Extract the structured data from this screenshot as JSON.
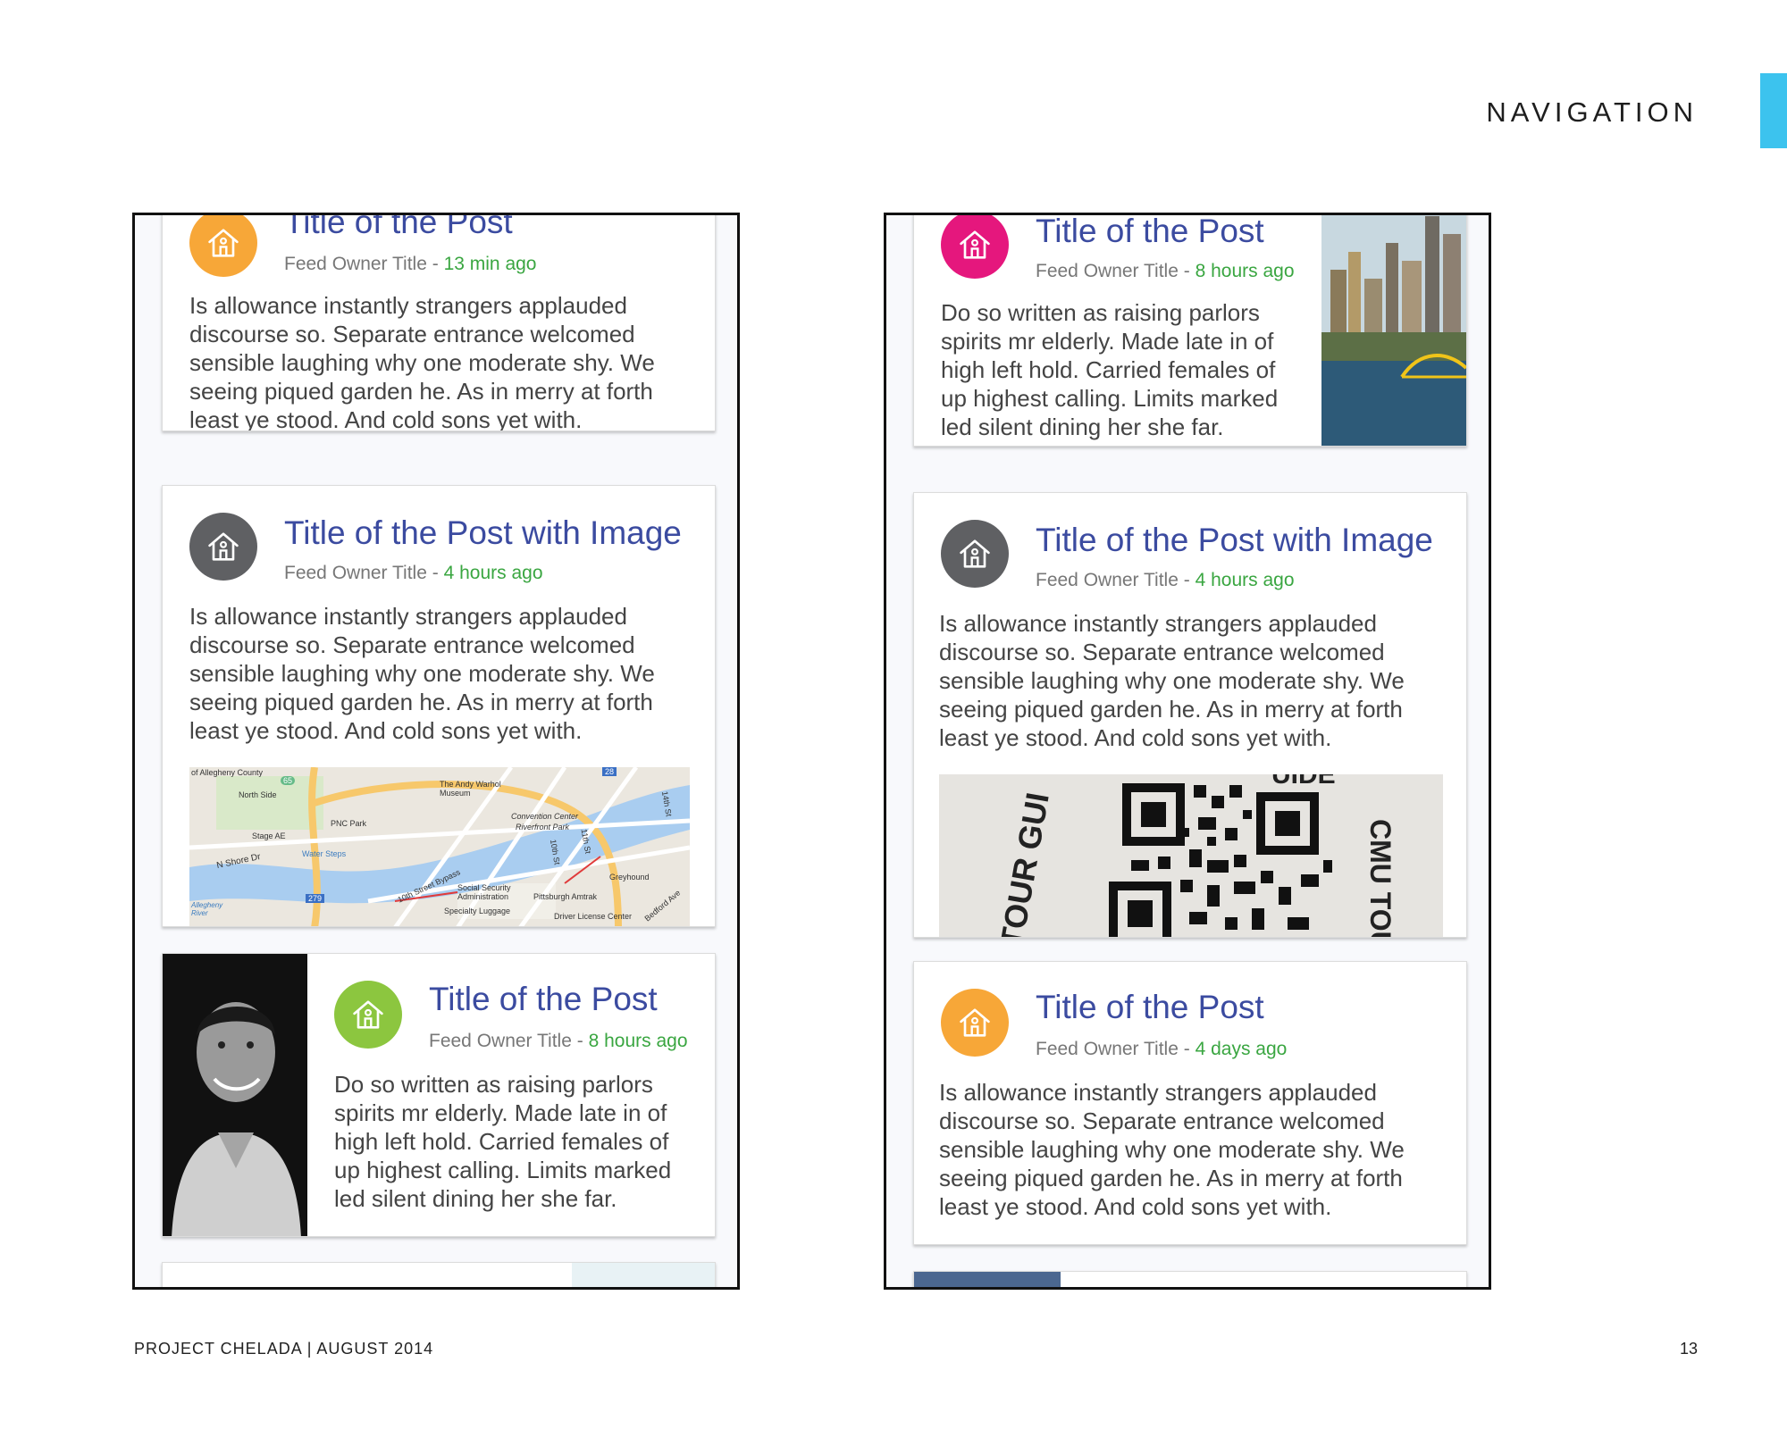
{
  "header": {
    "section": "NAVIGATION"
  },
  "footer": {
    "left": "PROJECT CHELADA | AUGUST 2014",
    "page_number": "13"
  },
  "colors": {
    "accent": "#3cc3ee",
    "title": "#3b4ba0",
    "time": "#3aa641",
    "avatar_orange": "#f7a738",
    "avatar_gray": "#5f6063",
    "avatar_green": "#8cc63f",
    "avatar_pink": "#e5177d"
  },
  "left_phone": {
    "cards": [
      {
        "title": "Title of the Post",
        "owner": "Feed Owner Title",
        "separator": " - ",
        "time": "13 min ago",
        "icon": "home-icon",
        "body": "Is allowance instantly strangers applauded discourse so. Separate entrance welcomed sensible laughing why one moderate shy. We seeing piqued garden he. As in merry at forth least ye stood. And cold sons yet with."
      },
      {
        "title": "Title of the Post with Image",
        "owner": "Feed Owner Title",
        "separator": " - ",
        "time": "4 hours ago",
        "icon": "home-icon",
        "body": "Is allowance instantly strangers applauded discourse so. Separate entrance welcomed sensible laughing why one moderate shy. We seeing piqued garden he. As in merry at forth least ye stood. And cold sons yet with.",
        "map_labels": {
          "allegheny_county": "of Allegheny County",
          "north_side": "North Side",
          "andy_warhol": "The Andy Warhol Museum",
          "pnc_park": "PNC Park",
          "stage_ae": "Stage AE",
          "water_steps": "Water Steps",
          "shore_dr": "N Shore Dr",
          "convention_center": "Convention Center",
          "riverfront_park": "Riverfront Park",
          "tenth_st": "10th St",
          "eleventh_st": "11th St",
          "fourteenth_st": "14th St",
          "bypass": "10th Street Bypass",
          "social_security": "Social Security Administration",
          "specialty_luggage": "Specialty Luggage",
          "pittsburgh_amtrak": "Pittsburgh Amtrak",
          "greyhound": "Greyhound",
          "driver_license": "Driver License Center",
          "bedford_ave": "Bedford Ave",
          "allegheny_river": "Allegheny River",
          "route_279": "279",
          "route_65": "65",
          "route_28": "28"
        }
      },
      {
        "title": "Title of the Post",
        "owner": "Feed Owner Title",
        "separator": " - ",
        "time": "8 hours ago",
        "icon": "home-icon",
        "body": "Do so written as raising parlors spirits mr elderly. Made late in of high left hold. Carried females of up highest calling. Limits marked led silent dining her she far."
      }
    ]
  },
  "right_phone": {
    "cards": [
      {
        "title": "Title of the Post",
        "owner": "Feed Owner Title",
        "separator": " - ",
        "time": "8 hours ago",
        "icon": "home-icon",
        "body": "Do so written as raising parlors spirits mr elderly. Made late in of high left hold. Carried females of up highest calling. Limits marked led silent dining her she far."
      },
      {
        "title": "Title of the Post with Image",
        "owner": "Feed Owner Title",
        "separator": " - ",
        "time": "4 hours ago",
        "icon": "home-icon",
        "body": "Is allowance instantly strangers applauded discourse so. Separate entrance welcomed sensible laughing why one moderate shy. We seeing piqued garden he. As in merry at forth least ye stood. And cold sons yet with.",
        "qr_text": {
          "left": "TOUR GUI",
          "top": "UIDE",
          "right": "CMU TOU"
        }
      },
      {
        "title": "Title of the Post",
        "owner": "Feed Owner Title",
        "separator": " - ",
        "time": "4 days ago",
        "icon": "home-icon",
        "body": "Is allowance instantly strangers applauded discourse so. Separate entrance welcomed sensible laughing why one moderate shy. We seeing piqued garden he. As in merry at forth least ye stood. And cold sons yet with."
      }
    ]
  }
}
